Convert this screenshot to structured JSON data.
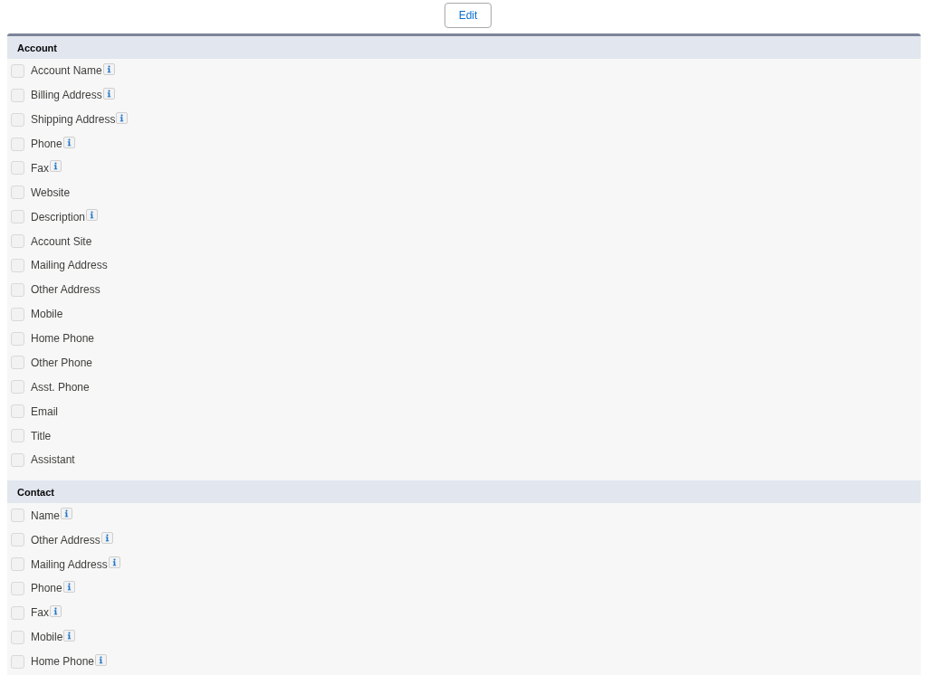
{
  "edit_button": {
    "label": "Edit"
  },
  "sections": [
    {
      "title": "Account",
      "fields": [
        {
          "label": "Account Name",
          "checked": false,
          "has_info": true
        },
        {
          "label": "Billing Address",
          "checked": false,
          "has_info": true
        },
        {
          "label": "Shipping Address",
          "checked": false,
          "has_info": true
        },
        {
          "label": "Phone",
          "checked": false,
          "has_info": true
        },
        {
          "label": "Fax",
          "checked": false,
          "has_info": true
        },
        {
          "label": "Website",
          "checked": false,
          "has_info": false
        },
        {
          "label": "Description",
          "checked": false,
          "has_info": true
        },
        {
          "label": "Account Site",
          "checked": false,
          "has_info": false
        },
        {
          "label": "Mailing Address",
          "checked": false,
          "has_info": false
        },
        {
          "label": "Other Address",
          "checked": false,
          "has_info": false
        },
        {
          "label": "Mobile",
          "checked": false,
          "has_info": false
        },
        {
          "label": "Home Phone",
          "checked": false,
          "has_info": false
        },
        {
          "label": "Other Phone",
          "checked": false,
          "has_info": false
        },
        {
          "label": "Asst. Phone",
          "checked": false,
          "has_info": false
        },
        {
          "label": "Email",
          "checked": false,
          "has_info": false
        },
        {
          "label": "Title",
          "checked": false,
          "has_info": false
        },
        {
          "label": "Assistant",
          "checked": false,
          "has_info": false
        }
      ]
    },
    {
      "title": "Contact",
      "fields": [
        {
          "label": "Name",
          "checked": false,
          "has_info": true
        },
        {
          "label": "Other Address",
          "checked": false,
          "has_info": true
        },
        {
          "label": "Mailing Address",
          "checked": false,
          "has_info": true
        },
        {
          "label": "Phone",
          "checked": false,
          "has_info": true
        },
        {
          "label": "Fax",
          "checked": false,
          "has_info": true
        },
        {
          "label": "Mobile",
          "checked": false,
          "has_info": true
        },
        {
          "label": "Home Phone",
          "checked": false,
          "has_info": true
        }
      ]
    }
  ]
}
